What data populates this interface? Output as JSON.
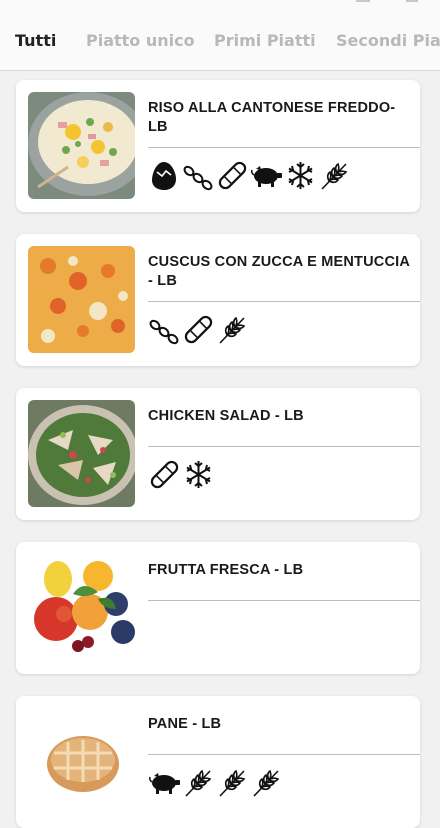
{
  "tabs": [
    {
      "label": "Tutti",
      "active": true
    },
    {
      "label": "Piatto unico",
      "active": false
    },
    {
      "label": "Primi Piatti",
      "active": false
    },
    {
      "label": "Secondi Piatti",
      "active": false
    }
  ],
  "dishes": [
    {
      "title": "RISO ALLA CANTONESE FREDDO-LB",
      "image": "rice-salad",
      "allergens": [
        "egg-icon",
        "chain-icon",
        "bandage-icon",
        "pig-icon",
        "snowflake-icon",
        "wheat-icon"
      ]
    },
    {
      "title": "CUSCUS CON ZUCCA E MENTUCCIA - LB",
      "image": "couscous",
      "allergens": [
        "chain-icon",
        "bandage-icon",
        "wheat-icon"
      ]
    },
    {
      "title": "CHICKEN SALAD - LB",
      "image": "chicken-salad",
      "allergens": [
        "bandage-icon",
        "snowflake-icon"
      ]
    },
    {
      "title": "FRUTTA FRESCA - LB",
      "image": "fresh-fruit",
      "allergens": []
    },
    {
      "title": "PANE - LB",
      "image": "bread",
      "allergens": [
        "pig-icon",
        "wheat-icon",
        "wheat-icon",
        "wheat-icon"
      ]
    }
  ]
}
